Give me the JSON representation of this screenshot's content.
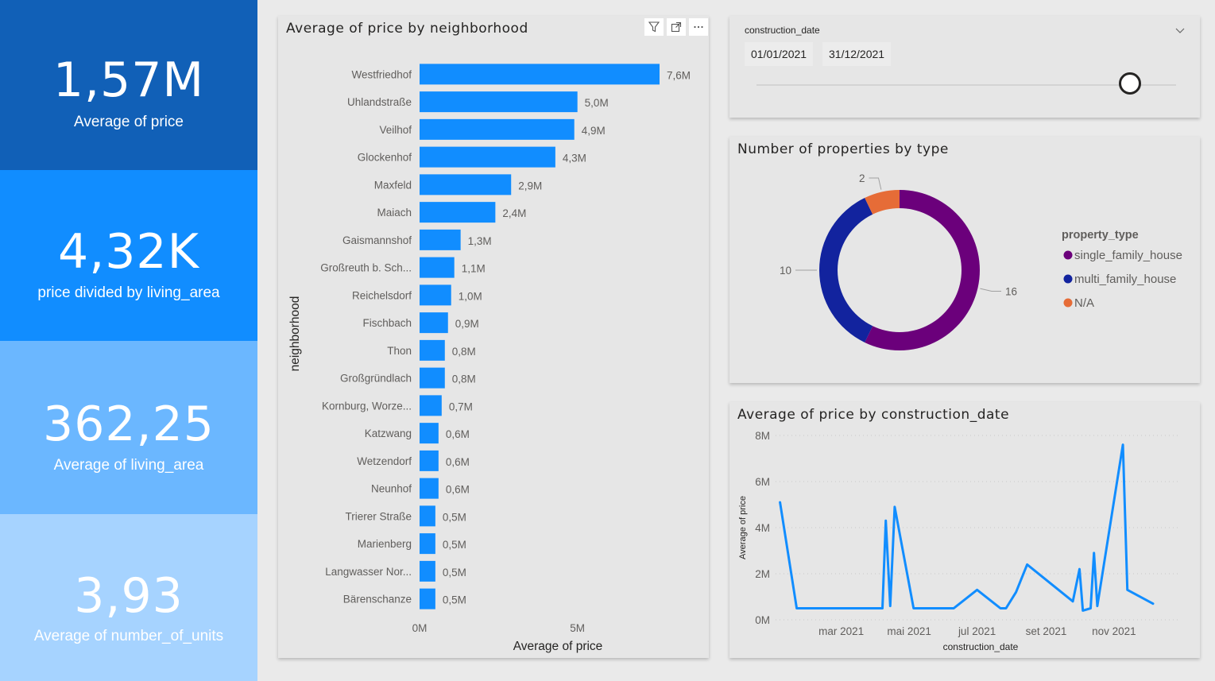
{
  "kpis": [
    {
      "value": "1,57M",
      "label": "Average of price",
      "color": "#1160b7"
    },
    {
      "value": "4,32K",
      "label": "price divided by living_area",
      "color": "#118dff"
    },
    {
      "value": "362,25",
      "label": "Average of living_area",
      "color": "#6bb7ff"
    },
    {
      "value": "3,93",
      "label": "Average of number_of_units",
      "color": "#a6d3ff"
    }
  ],
  "bar_chart": {
    "title": "Average of price by neighborhood",
    "color": "#118dff"
  },
  "slicer": {
    "title": "construction_date",
    "start": "01/01/2021",
    "end": "31/12/2021"
  },
  "donut_chart": {
    "title": "Number of properties by type"
  },
  "line_chart": {
    "title": "Average of price by construction_date",
    "color": "#118dff"
  },
  "chart_data": [
    {
      "type": "bar",
      "orientation": "horizontal",
      "title": "Average of price by neighborhood",
      "xlabel": "Average of price",
      "ylabel": "neighborhood",
      "xlim": [
        0,
        7600000
      ],
      "xticks": [
        "0M",
        "5M"
      ],
      "categories": [
        "Westfriedhof",
        "Uhlandstraße",
        "Veilhof",
        "Glockenhof",
        "Maxfeld",
        "Maiach",
        "Gaismannshof",
        "Großreuth b. Sch...",
        "Reichelsdorf",
        "Fischbach",
        "Thon",
        "Großgründlach",
        "Kornburg, Worze...",
        "Katzwang",
        "Wetzendorf",
        "Neunhof",
        "Trierer Straße",
        "Marienberg",
        "Langwasser Nor...",
        "Bärenschanze"
      ],
      "values": [
        7600000,
        5000000,
        4900000,
        4300000,
        2900000,
        2400000,
        1300000,
        1100000,
        1000000,
        900000,
        800000,
        800000,
        700000,
        600000,
        600000,
        600000,
        500000,
        500000,
        500000,
        500000
      ],
      "data_labels": [
        "7,6M",
        "5,0M",
        "4,9M",
        "4,3M",
        "2,9M",
        "2,4M",
        "1,3M",
        "1,1M",
        "1,0M",
        "0,9M",
        "0,8M",
        "0,8M",
        "0,7M",
        "0,6M",
        "0,6M",
        "0,6M",
        "0,5M",
        "0,5M",
        "0,5M",
        "0,5M"
      ]
    },
    {
      "type": "pie",
      "variant": "donut",
      "title": "Number of properties by type",
      "legend_title": "property_type",
      "legend_position": "right",
      "series": [
        {
          "name": "single_family_house",
          "value": 16,
          "color": "#6b007b"
        },
        {
          "name": "multi_family_house",
          "value": 10,
          "color": "#12239e"
        },
        {
          "name": "N/A",
          "value": 2,
          "color": "#e66c37"
        }
      ]
    },
    {
      "type": "line",
      "title": "Average of price by construction_date",
      "xlabel": "construction_date",
      "ylabel": "Average of price",
      "ylim": [
        0,
        8000000
      ],
      "yticks": [
        "0M",
        "2M",
        "4M",
        "6M",
        "8M"
      ],
      "xlim": [
        "2021-01-01",
        "2021-12-31"
      ],
      "xticks": [
        {
          "label": "mar 2021",
          "date": "2021-03-01"
        },
        {
          "label": "mai 2021",
          "date": "2021-05-01"
        },
        {
          "label": "jul 2021",
          "date": "2021-07-01"
        },
        {
          "label": "set 2021",
          "date": "2021-09-01"
        },
        {
          "label": "nov 2021",
          "date": "2021-11-01"
        }
      ],
      "grid": true,
      "points": [
        {
          "date": "2021-01-05",
          "value": 5100000
        },
        {
          "date": "2021-01-20",
          "value": 500000
        },
        {
          "date": "2021-04-07",
          "value": 500000
        },
        {
          "date": "2021-04-10",
          "value": 4300000
        },
        {
          "date": "2021-04-14",
          "value": 600000
        },
        {
          "date": "2021-04-18",
          "value": 4900000
        },
        {
          "date": "2021-05-05",
          "value": 500000
        },
        {
          "date": "2021-06-10",
          "value": 500000
        },
        {
          "date": "2021-07-01",
          "value": 1300000
        },
        {
          "date": "2021-07-22",
          "value": 500000
        },
        {
          "date": "2021-07-27",
          "value": 500000
        },
        {
          "date": "2021-08-05",
          "value": 1200000
        },
        {
          "date": "2021-08-15",
          "value": 2400000
        },
        {
          "date": "2021-09-25",
          "value": 800000
        },
        {
          "date": "2021-10-01",
          "value": 2200000
        },
        {
          "date": "2021-10-04",
          "value": 400000
        },
        {
          "date": "2021-10-11",
          "value": 500000
        },
        {
          "date": "2021-10-14",
          "value": 2900000
        },
        {
          "date": "2021-10-17",
          "value": 600000
        },
        {
          "date": "2021-11-09",
          "value": 7600000
        },
        {
          "date": "2021-11-13",
          "value": 1300000
        },
        {
          "date": "2021-12-06",
          "value": 700000
        }
      ]
    }
  ]
}
